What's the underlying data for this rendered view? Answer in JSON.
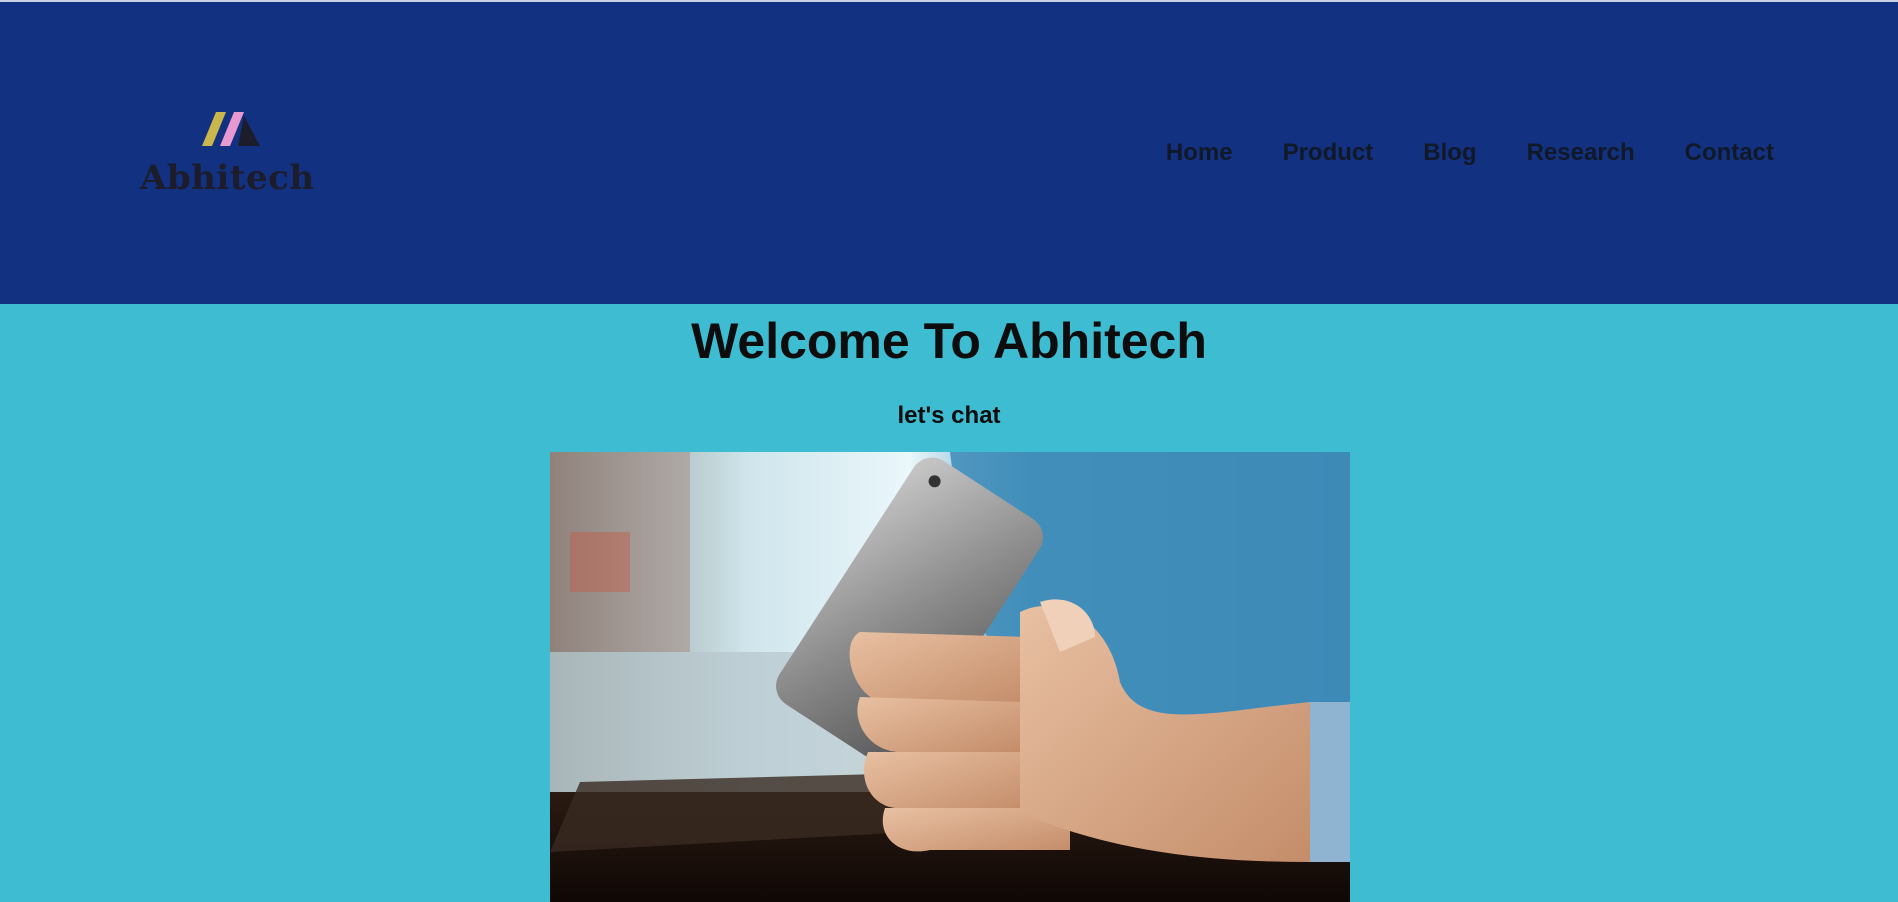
{
  "colors": {
    "header_bg": "#123181",
    "page_bg": "#3ebdd2",
    "text": "#0d0d0d",
    "logo_stripe_yellow": "#c9b64d",
    "logo_stripe_pink": "#e89ad0"
  },
  "brand": {
    "name": "Abhitech",
    "logo_icon": "abhitech-logo-mark"
  },
  "nav": {
    "items": [
      {
        "label": "Home"
      },
      {
        "label": "Product"
      },
      {
        "label": "Blog"
      },
      {
        "label": "Research"
      },
      {
        "label": "Contact"
      }
    ]
  },
  "hero": {
    "title": "Welcome To Abhitech",
    "subtitle": "let's chat"
  }
}
